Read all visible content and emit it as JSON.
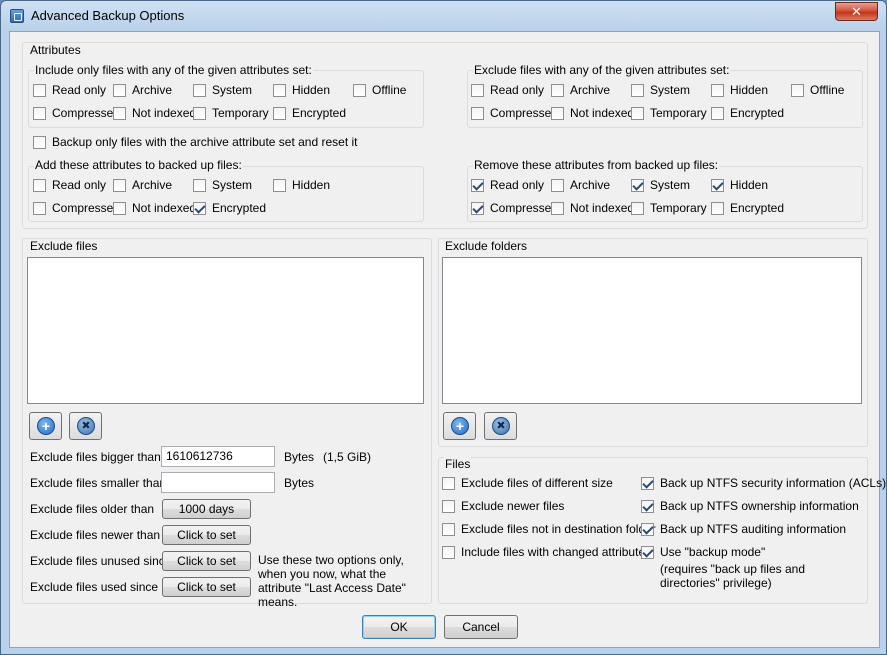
{
  "window": {
    "title": "Advanced Backup Options",
    "close_glyph": "✕"
  },
  "attributes": {
    "label": "Attributes",
    "include_only": {
      "label": "Include only files with any of the given attributes set:",
      "items": [
        {
          "label": "Read only",
          "checked": false
        },
        {
          "label": "Archive",
          "checked": false
        },
        {
          "label": "System",
          "checked": false
        },
        {
          "label": "Hidden",
          "checked": false
        },
        {
          "label": "Offline",
          "checked": false
        },
        {
          "label": "Compressed",
          "checked": false
        },
        {
          "label": "Not indexed",
          "checked": false
        },
        {
          "label": "Temporary",
          "checked": false
        },
        {
          "label": "Encrypted",
          "checked": false
        }
      ]
    },
    "exclude_files_attr": {
      "label": "Exclude files with any of the given attributes set:",
      "items": [
        {
          "label": "Read only",
          "checked": false
        },
        {
          "label": "Archive",
          "checked": false
        },
        {
          "label": "System",
          "checked": false
        },
        {
          "label": "Hidden",
          "checked": false
        },
        {
          "label": "Offline",
          "checked": false
        },
        {
          "label": "Compressed",
          "checked": false
        },
        {
          "label": "Not indexed",
          "checked": false
        },
        {
          "label": "Temporary",
          "checked": false
        },
        {
          "label": "Encrypted",
          "checked": false
        }
      ]
    },
    "archive_reset": {
      "label": "Backup only files with the archive attribute set and reset it",
      "checked": false
    },
    "add_attrs": {
      "label": "Add these attributes to backed up files:",
      "items": [
        {
          "label": "Read only",
          "checked": false
        },
        {
          "label": "Archive",
          "checked": false
        },
        {
          "label": "System",
          "checked": false
        },
        {
          "label": "Hidden",
          "checked": false
        },
        {
          "label": "Compressed",
          "checked": false
        },
        {
          "label": "Not indexed",
          "checked": false
        },
        {
          "label": "Encrypted",
          "checked": true
        }
      ]
    },
    "remove_attrs": {
      "label": "Remove these attributes from backed up files:",
      "items": [
        {
          "label": "Read only",
          "checked": true
        },
        {
          "label": "Archive",
          "checked": false
        },
        {
          "label": "System",
          "checked": true
        },
        {
          "label": "Hidden",
          "checked": true
        },
        {
          "label": "Compressed",
          "checked": true
        },
        {
          "label": "Not indexed",
          "checked": false
        },
        {
          "label": "Temporary",
          "checked": false
        },
        {
          "label": "Encrypted",
          "checked": false
        }
      ]
    }
  },
  "exclude_files": {
    "label": "Exclude files",
    "add_icon": "plus-icon",
    "remove_icon": "cross-icon",
    "add_glyph": "+",
    "remove_glyph": "✖",
    "bigger": {
      "label": "Exclude files bigger than",
      "value": "1610612736",
      "unit": "Bytes",
      "human": "(1,5 GiB)"
    },
    "smaller": {
      "label": "Exclude files smaller than",
      "value": "",
      "unit": "Bytes"
    },
    "older": {
      "label": "Exclude files older than",
      "button": "1000 days"
    },
    "newer": {
      "label": "Exclude files newer than",
      "button": "Click to set"
    },
    "unused": {
      "label": "Exclude files unused since",
      "button": "Click to set"
    },
    "used": {
      "label": "Exclude files used since",
      "button": "Click to set"
    },
    "note": "Use these two options only, when you now, what the attribute \"Last Access Date\" means."
  },
  "exclude_folders": {
    "label": "Exclude folders",
    "add_glyph": "+",
    "remove_glyph": "✖"
  },
  "files": {
    "label": "Files",
    "left": [
      {
        "label": "Exclude files of different size",
        "checked": false
      },
      {
        "label": "Exclude newer files",
        "checked": false
      },
      {
        "label": "Exclude files not in destination folder",
        "checked": false
      },
      {
        "label": "Include files with changed attributes",
        "checked": false
      }
    ],
    "right": [
      {
        "label": "Back up NTFS security information (ACLs)",
        "checked": true
      },
      {
        "label": "Back up NTFS ownership information",
        "checked": true
      },
      {
        "label": "Back up NTFS auditing information",
        "checked": true
      },
      {
        "label": "Use \"backup mode\"",
        "checked": true
      }
    ],
    "backup_mode_note": "(requires \"back up files and directories\" privilege)"
  },
  "buttons": {
    "ok": "OK",
    "cancel": "Cancel"
  }
}
